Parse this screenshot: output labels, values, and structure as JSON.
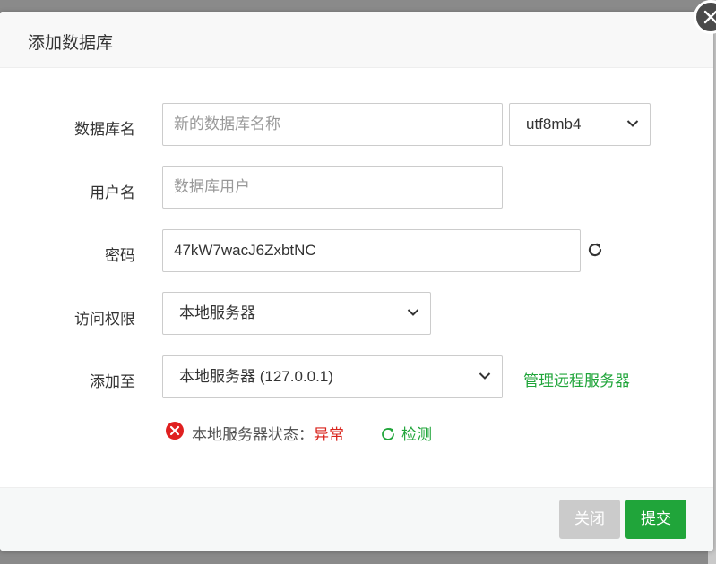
{
  "dialog": {
    "title": "添加数据库",
    "close_icon": "close-x-icon"
  },
  "form": {
    "db_name": {
      "label": "数据库名",
      "value": "",
      "placeholder": "新的数据库名称"
    },
    "charset": {
      "value": "utf8mb4"
    },
    "username": {
      "label": "用户名",
      "value": "",
      "placeholder": "数据库用户"
    },
    "password": {
      "label": "密码",
      "value": "47kW7wacJ6ZxbtNC",
      "refresh_icon": "refresh-icon"
    },
    "access": {
      "label": "访问权限",
      "value": "本地服务器"
    },
    "add_to": {
      "label": "添加至",
      "value": "本地服务器 (127.0.0.1)",
      "manage_link": "管理远程服务器"
    },
    "status": {
      "label": "本地服务器状态：",
      "value": "异常",
      "check_label": "检测",
      "error_color": "#d9241c"
    }
  },
  "footer": {
    "close_label": "关闭",
    "submit_label": "提交"
  },
  "colors": {
    "accent": "#20a53a",
    "error": "#d9241c",
    "disabled": "#cbcbcb"
  }
}
